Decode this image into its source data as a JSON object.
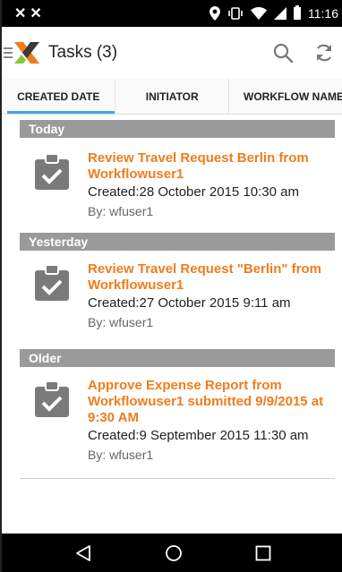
{
  "status_bar": {
    "left_icons": [
      "x-notification-icon",
      "x-notification-icon"
    ],
    "time": "11:16"
  },
  "action_bar": {
    "title": "Tasks (3)",
    "icons": [
      "drawer-icon",
      "nintex-logo-icon",
      "search-icon",
      "refresh-icon"
    ]
  },
  "tabs": [
    {
      "label": "CREATED DATE",
      "active": true
    },
    {
      "label": "INITIATOR",
      "active": false
    },
    {
      "label": "WORKFLOW NAME",
      "active": false
    }
  ],
  "sections": [
    {
      "header": "Today",
      "tasks": [
        {
          "title": "Review Travel Request Berlin from Workflowuser1",
          "created": "Created:28 October 2015 10:30 am",
          "by": "By: wfuser1"
        }
      ]
    },
    {
      "header": "Yesterday",
      "tasks": [
        {
          "title": "Review Travel Request \"Berlin\" from Workflowuser1",
          "created": "Created:27 October 2015 9:11 am",
          "by": "By: wfuser1"
        }
      ]
    },
    {
      "header": "Older",
      "tasks": [
        {
          "title": "Approve Expense Report from Workflowuser1 submitted 9/9/2015 at 9:30 AM",
          "created": "Created:9 September 2015 11:30 am",
          "by": "By: wfuser1"
        }
      ]
    }
  ],
  "nav_bar": {
    "icons": [
      "back-icon",
      "home-icon",
      "recents-icon"
    ]
  },
  "colors": {
    "accent_orange": "#f07c1c",
    "tab_indicator": "#4aa3df",
    "section_header": "#9a9a9a"
  }
}
